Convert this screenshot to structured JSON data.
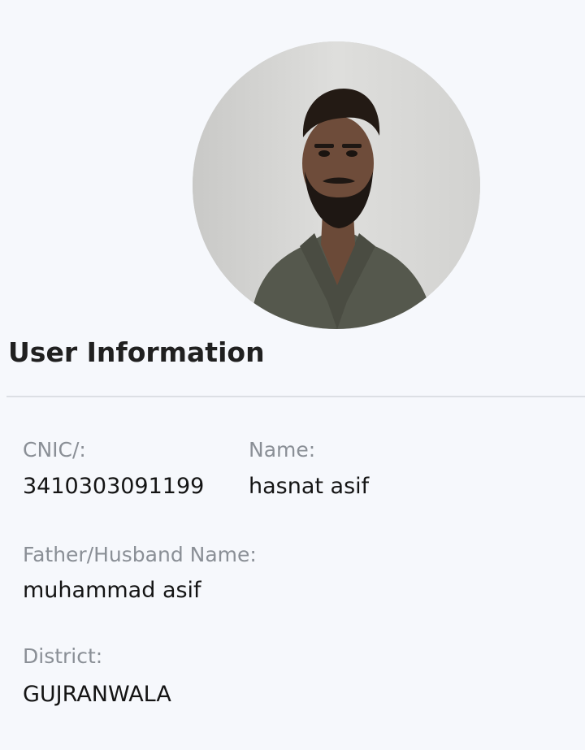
{
  "profile": {
    "avatar_icon": "user-photo"
  },
  "section": {
    "title": "User Information"
  },
  "fields": {
    "cnic": {
      "label": "CNIC/:",
      "value": "3410303091199"
    },
    "name": {
      "label": "Name:",
      "value": "hasnat asif"
    },
    "father": {
      "label": "Father/Husband Name:",
      "value": "muhammad asif"
    },
    "district": {
      "label": "District:",
      "value": "GUJRANWALA"
    }
  }
}
